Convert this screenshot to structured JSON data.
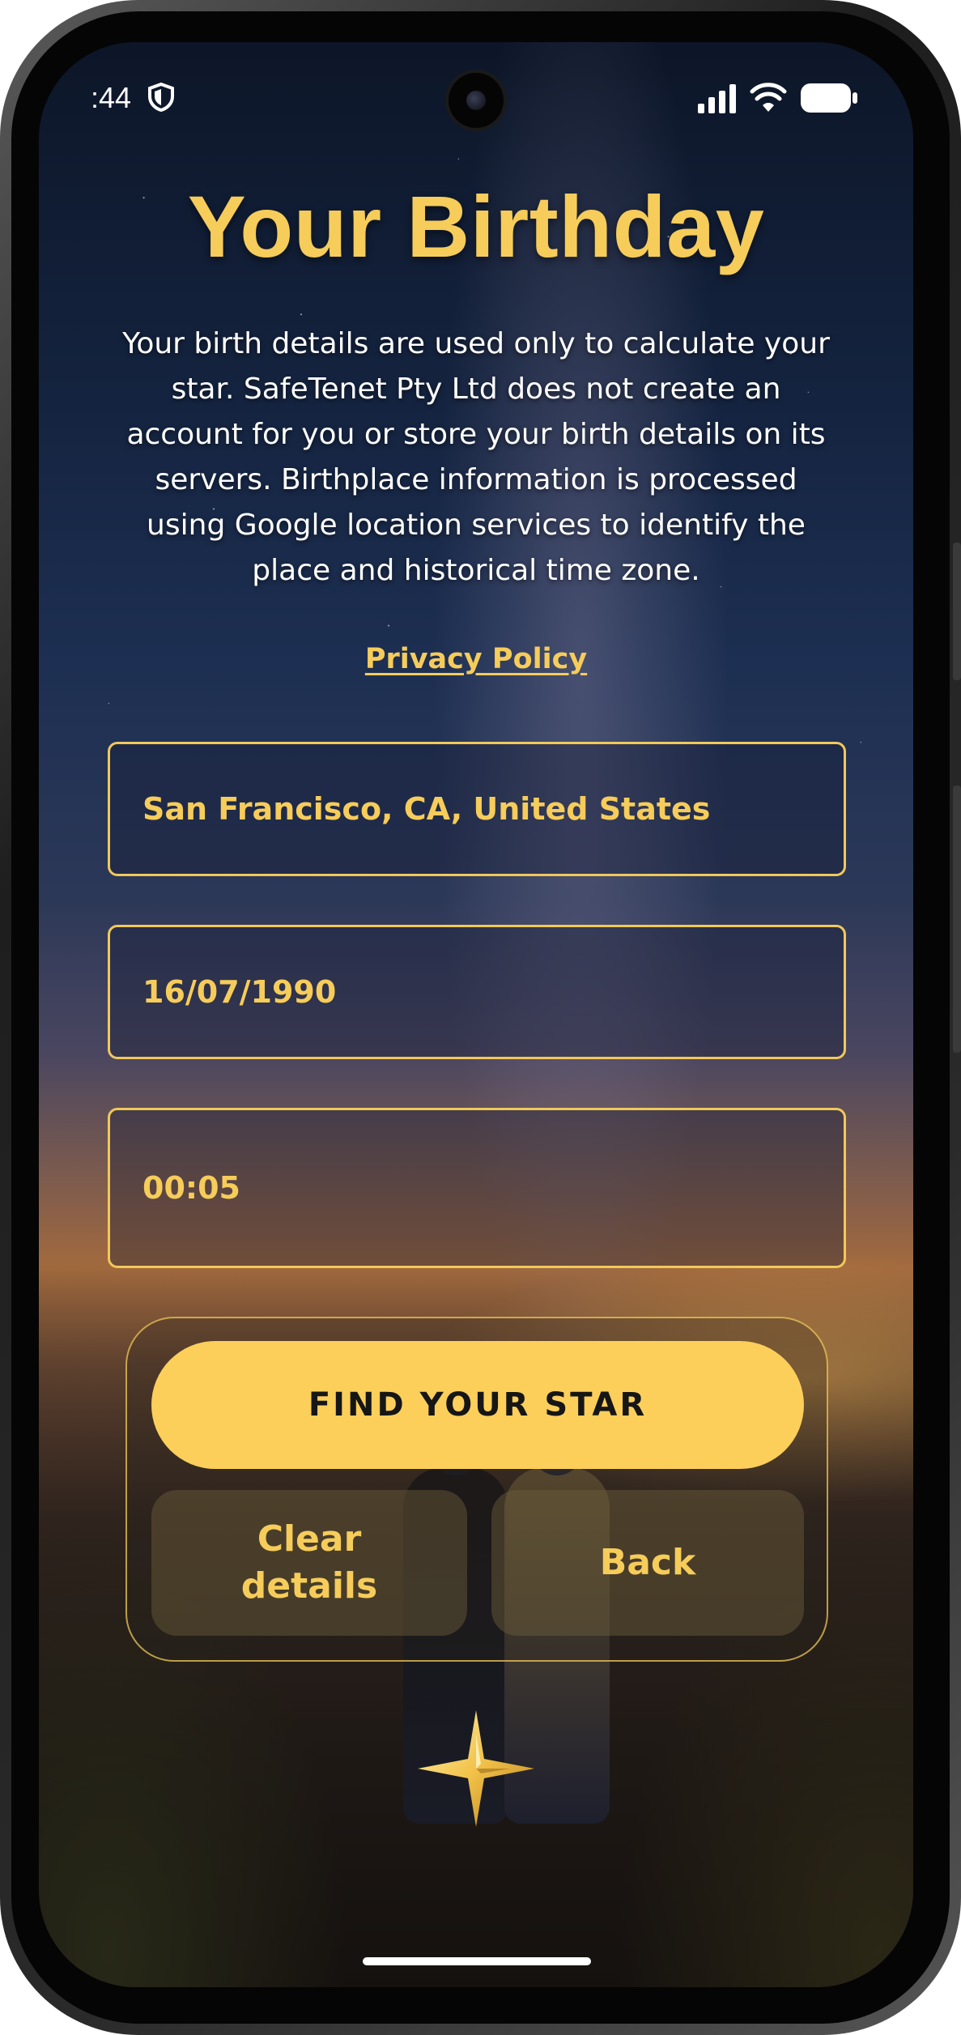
{
  "status_bar": {
    "time": ":44"
  },
  "page": {
    "title": "Your Birthday",
    "description": "Your birth details are used only to calculate your star. SafeTenet Pty Ltd does not create an account for you or store your birth details on its servers. Birthplace information is processed using Google location services to identify the place and historical time zone.",
    "privacy_link": "Privacy Policy"
  },
  "form": {
    "birthplace": {
      "value": "San Francisco, CA, United States"
    },
    "birth_date": {
      "value": "16/07/1990"
    },
    "birth_time": {
      "value": "00:05"
    }
  },
  "actions": {
    "find_label": "FIND YOUR STAR",
    "clear_label": "Clear details",
    "back_label": "Back"
  },
  "colors": {
    "accent": "#f6cc5a",
    "button_bg": "#fccf5b",
    "button_text": "#161616"
  },
  "icons": {
    "status_shield": "shield-icon",
    "signal": "signal-icon",
    "wifi": "wifi-icon",
    "battery": "battery-icon",
    "decoration": "compass-star-icon"
  }
}
